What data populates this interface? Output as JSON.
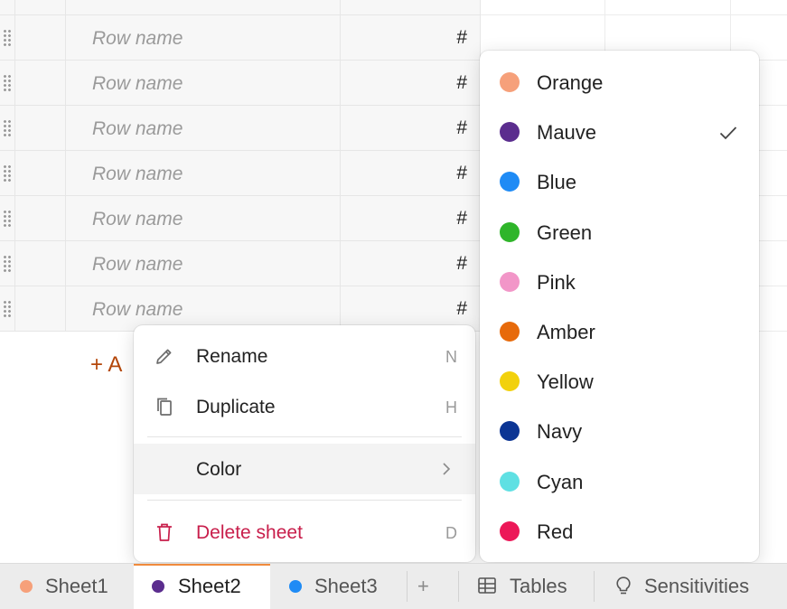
{
  "grid": {
    "rows": [
      {
        "name_placeholder": "Row name",
        "value": "#"
      },
      {
        "name_placeholder": "Row name",
        "value": "#"
      },
      {
        "name_placeholder": "Row name",
        "value": "#"
      },
      {
        "name_placeholder": "Row name",
        "value": "#"
      },
      {
        "name_placeholder": "Row name",
        "value": "#"
      },
      {
        "name_placeholder": "Row name",
        "value": "#"
      },
      {
        "name_placeholder": "Row name",
        "value": "#"
      }
    ],
    "add_row_label": "+ A"
  },
  "context_menu": {
    "items": [
      {
        "label": "Rename",
        "shortcut": "N",
        "icon": "pencil-icon"
      },
      {
        "label": "Duplicate",
        "shortcut": "H",
        "icon": "copy-icon"
      },
      {
        "label": "Color",
        "shortcut": "›",
        "icon": "chevron-right-icon"
      },
      {
        "label": "Delete sheet",
        "shortcut": "D",
        "icon": "trash-icon"
      }
    ]
  },
  "color_menu": {
    "selected": "Mauve",
    "items": [
      {
        "label": "Orange",
        "color": "#f6a07a"
      },
      {
        "label": "Mauve",
        "color": "#5b2d8e"
      },
      {
        "label": "Blue",
        "color": "#1f8bf5"
      },
      {
        "label": "Green",
        "color": "#2fb52a"
      },
      {
        "label": "Pink",
        "color": "#f296c8"
      },
      {
        "label": "Amber",
        "color": "#e76a0b"
      },
      {
        "label": "Yellow",
        "color": "#f2d10c"
      },
      {
        "label": "Navy",
        "color": "#0c3594"
      },
      {
        "label": "Cyan",
        "color": "#5fe0e3"
      },
      {
        "label": "Red",
        "color": "#ec1858"
      }
    ]
  },
  "tabs": {
    "sheets": [
      {
        "label": "Sheet1",
        "color": "#f6a07a"
      },
      {
        "label": "Sheet2",
        "color": "#5b2d8e"
      },
      {
        "label": "Sheet3",
        "color": "#1f8bf5"
      }
    ],
    "add_symbol": "+",
    "tables_label": "Tables",
    "sensitivities_label": "Sensitivities",
    "active_color": "#f08a3c"
  }
}
